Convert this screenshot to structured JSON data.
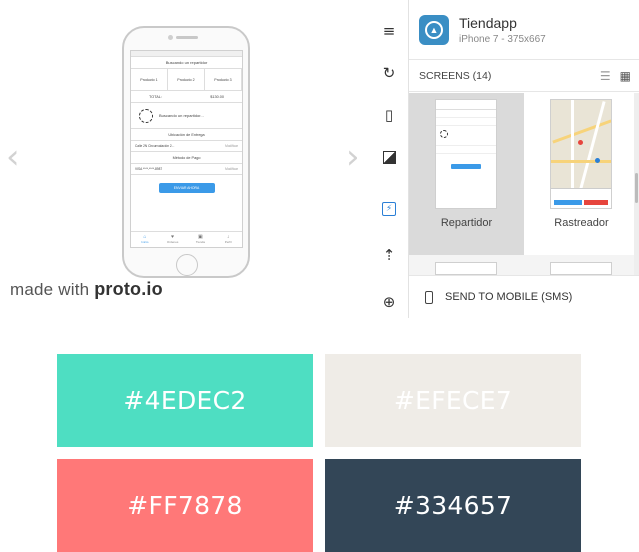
{
  "preview": {
    "made_with_prefix": "made with",
    "made_with_brand": "proto.io",
    "nav_left_icon": "chevron-left-icon",
    "nav_right_icon": "chevron-right-icon",
    "screen": {
      "title": "Buscando un repartidor",
      "products": [
        "Producto 1",
        "Producto 2",
        "Producto 3"
      ],
      "total_label": "TOTAL:",
      "total_value": "$130.00",
      "searching_text": "Buscando un repartidor...",
      "delivery_location_label": "Ubicación de Entrega",
      "address_row": {
        "left": "Calle 2N Circunvalación 2...",
        "right": "Modificar"
      },
      "payment_label": "Método de Pago",
      "card_row": {
        "left": "VISA ****-****-8987",
        "right": "Modificar"
      },
      "cta": "ENVIAR AHORA",
      "tabs": [
        "Inicio",
        "Ordenes",
        "Tienda",
        "Perfil"
      ]
    }
  },
  "toolbar": {
    "tools": [
      "menu-icon",
      "refresh-icon",
      "rotate-device-icon",
      "contrast-icon",
      "flash-icon",
      "upload-icon",
      "zoom-icon"
    ],
    "active": "flash-icon"
  },
  "panel": {
    "app_name": "Tiendapp",
    "app_subtitle": "iPhone 7 - 375x667",
    "screens_label": "SCREENS (14)",
    "view_modes": [
      "list-view-icon",
      "grid-view-icon"
    ],
    "screens": [
      {
        "label": "Repartidor",
        "selected": true
      },
      {
        "label": "Rastreador",
        "selected": false
      }
    ],
    "send_label": "SEND TO MOBILE (SMS)"
  },
  "palette": [
    {
      "hex": "#4EDEC2",
      "label": "#4EDEC2"
    },
    {
      "hex": "#EFECE7",
      "label": "#EFECE7"
    },
    {
      "hex": "#FF7878",
      "label": "#FF7878"
    },
    {
      "hex": "#334657",
      "label": "#334657"
    }
  ]
}
